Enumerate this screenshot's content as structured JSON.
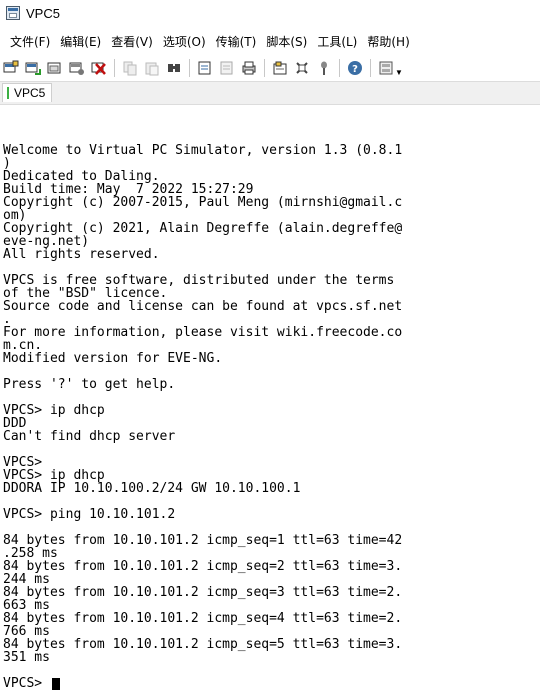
{
  "window": {
    "title": "VPC5"
  },
  "menu": {
    "items": [
      "文件(F)",
      "编辑(E)",
      "查看(V)",
      "选项(O)",
      "传输(T)",
      "脚本(S)",
      "工具(L)",
      "帮助(H)"
    ]
  },
  "toolbar": {
    "groups": [
      [
        "new-connection-icon",
        "reconnect-icon",
        "open-folder-icon",
        "disconnect-icon",
        "close-icon"
      ],
      [
        "copy-icon",
        "paste-icon",
        "find-icon"
      ],
      [
        "print-icon",
        "print-preview-icon",
        "printer-icon"
      ],
      [
        "settings-icon",
        "keymap-icon",
        "pin-icon"
      ],
      [
        "help-icon"
      ],
      [
        "options-icon"
      ]
    ]
  },
  "tabs": [
    {
      "label": "VPC5",
      "status_color": "#3cb043"
    }
  ],
  "terminal": {
    "lines": [
      "Welcome to Virtual PC Simulator, version 1.3 (0.8.1",
      ")",
      "Dedicated to Daling.",
      "Build time: May  7 2022 15:27:29",
      "Copyright (c) 2007-2015, Paul Meng (mirnshi@gmail.c",
      "om)",
      "Copyright (c) 2021, Alain Degreffe (alain.degreffe@",
      "eve-ng.net)",
      "All rights reserved.",
      "",
      "VPCS is free software, distributed under the terms",
      "of the \"BSD\" licence.",
      "Source code and license can be found at vpcs.sf.net",
      ".",
      "For more information, please visit wiki.freecode.co",
      "m.cn.",
      "Modified version for EVE-NG.",
      "",
      "Press '?' to get help.",
      "",
      "VPCS> ip dhcp",
      "DDD",
      "Can't find dhcp server",
      "",
      "VPCS>",
      "VPCS> ip dhcp",
      "DDORA IP 10.10.100.2/24 GW 10.10.100.1",
      "",
      "VPCS> ping 10.10.101.2",
      "",
      "84 bytes from 10.10.101.2 icmp_seq=1 ttl=63 time=42",
      ".258 ms",
      "84 bytes from 10.10.101.2 icmp_seq=2 ttl=63 time=3.",
      "244 ms",
      "84 bytes from 10.10.101.2 icmp_seq=3 ttl=63 time=2.",
      "663 ms",
      "84 bytes from 10.10.101.2 icmp_seq=4 ttl=63 time=2.",
      "766 ms",
      "84 bytes from 10.10.101.2 icmp_seq=5 ttl=63 time=3.",
      "351 ms",
      ""
    ],
    "prompt": "VPCS> "
  }
}
